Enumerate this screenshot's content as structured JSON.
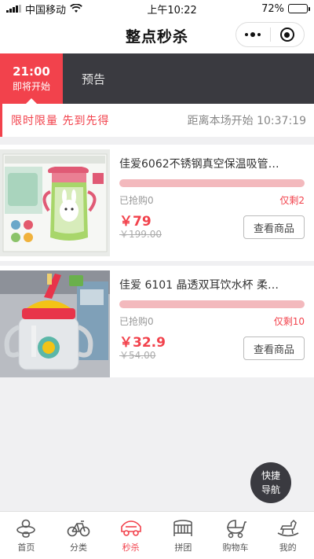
{
  "status_bar": {
    "carrier": "中国移动",
    "time": "上午10:22",
    "battery_text": "72%",
    "battery_level": 0.72
  },
  "nav": {
    "title": "整点秒杀"
  },
  "session_tabs": [
    {
      "time": "21:00",
      "status": "即将开始"
    },
    {
      "label": "预告"
    }
  ],
  "info": {
    "slogan": "限时限量 先到先得",
    "countdown_label": "距离本场开始",
    "countdown": "10:37:19"
  },
  "products": [
    {
      "name": "佳爱6062不锈钢真空保温吸管…",
      "progress": 0,
      "sold": "已抢购0",
      "remaining": "仅剩2",
      "price": "￥79",
      "old_price": "￥199.00",
      "button": "查看商品"
    },
    {
      "name": "佳爱 6101 晶透双耳饮水杯 柔…",
      "progress": 0,
      "sold": "已抢购0",
      "remaining": "仅剩10",
      "price": "￥32.9",
      "old_price": "￥54.00",
      "button": "查看商品"
    }
  ],
  "float_nav": {
    "line1": "快捷",
    "line2": "导航"
  },
  "tab_bar": [
    {
      "label": "首页",
      "icon": "pacifier-icon"
    },
    {
      "label": "分类",
      "icon": "bicycle-icon"
    },
    {
      "label": "秒杀",
      "icon": "car-icon",
      "active": true
    },
    {
      "label": "拼团",
      "icon": "crib-icon"
    },
    {
      "label": "购物车",
      "icon": "stroller-icon"
    },
    {
      "label": "我的",
      "icon": "rocking-horse-icon"
    }
  ],
  "colors": {
    "accent": "#f2424c",
    "dark": "#3a3a40",
    "progress_track": "#f3b9bd"
  }
}
